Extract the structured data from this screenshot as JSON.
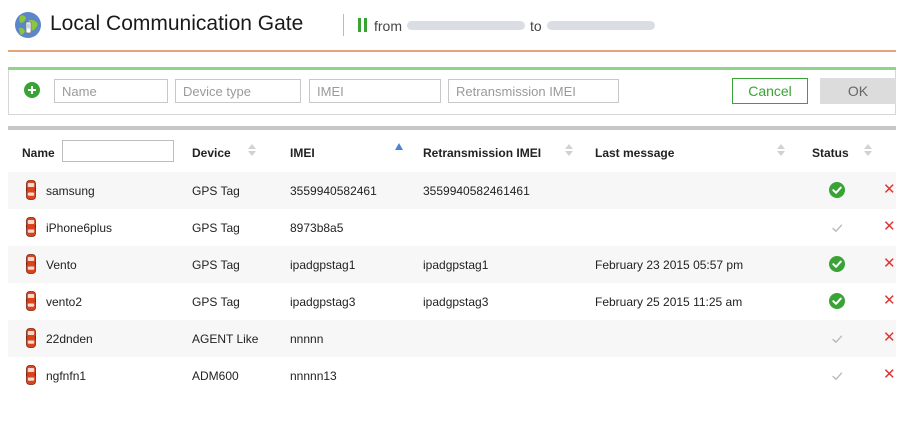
{
  "header": {
    "title": "Local Communication Gate",
    "from_label": "from",
    "to_label": "to"
  },
  "add_form": {
    "name_placeholder": "Name",
    "device_type_placeholder": "Device type",
    "imei_placeholder": "IMEI",
    "retrans_placeholder": "Retransmission IMEI",
    "cancel_label": "Cancel",
    "ok_label": "OK"
  },
  "table": {
    "columns": {
      "name": "Name",
      "device": "Device",
      "imei": "IMEI",
      "retrans": "Retransmission IMEI",
      "last_message": "Last message",
      "status": "Status"
    },
    "sorted_column": "IMEI",
    "rows": [
      {
        "name": "samsung",
        "device": "GPS Tag",
        "imei": "3559940582461",
        "retrans": "3559940582461461",
        "last_message": "",
        "status": "online"
      },
      {
        "name": "iPhone6plus",
        "device": "GPS Tag",
        "imei": "8973b8a5",
        "retrans": "",
        "last_message": "",
        "status": "offline"
      },
      {
        "name": "Vento",
        "device": "GPS Tag",
        "imei": "ipadgpstag1",
        "retrans": "ipadgpstag1",
        "last_message": "February 23 2015 05:57 pm",
        "status": "online"
      },
      {
        "name": "vento2",
        "device": "GPS Tag",
        "imei": "ipadgpstag3",
        "retrans": "ipadgpstag3",
        "last_message": "February 25 2015 11:25 am",
        "status": "online"
      },
      {
        "name": "22dnden",
        "device": "AGENT Like",
        "imei": "nnnnn",
        "retrans": "",
        "last_message": "",
        "status": "offline"
      },
      {
        "name": "ngfnfn1",
        "device": "ADM600",
        "imei": "nnnnn13",
        "retrans": "",
        "last_message": "",
        "status": "offline"
      }
    ]
  },
  "colors": {
    "accent_green": "#3aa335",
    "header_underline": "#e6a37a",
    "delete_red": "#e03535",
    "sort_active": "#4a84d4"
  },
  "icons": {
    "logo": "globe-logo-icon",
    "pause": "pause-icon",
    "add": "plus-circle-icon",
    "device": "car-icon",
    "online": "check-circle-icon",
    "offline": "check-icon",
    "delete": "close-icon"
  }
}
